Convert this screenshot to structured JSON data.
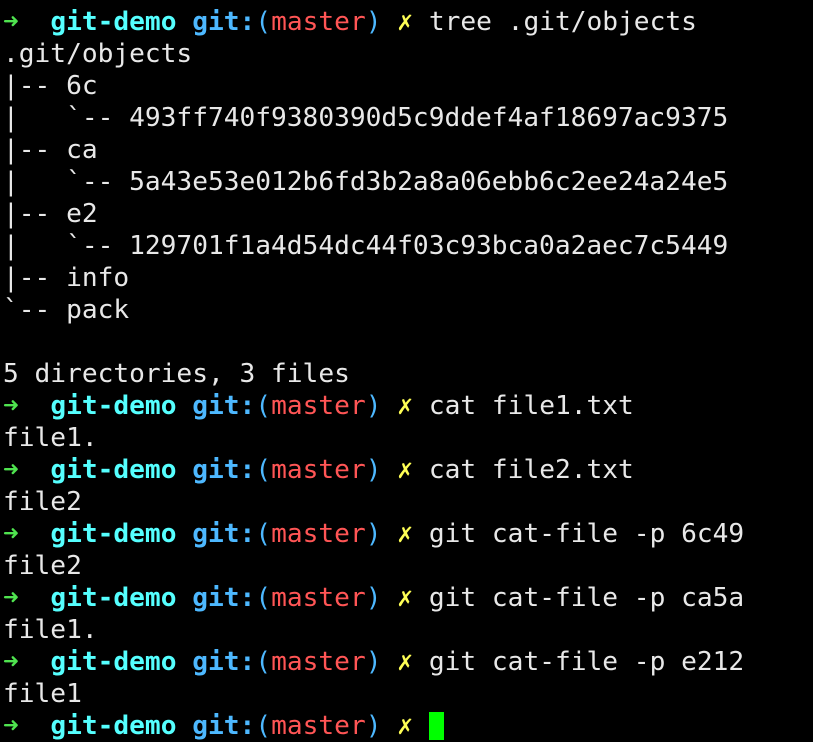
{
  "terminal": {
    "colors": {
      "arrow": "#4fe34f",
      "dir": "#55ffff",
      "git": "#4db8ff",
      "branch": "#ff5555",
      "dirty": "#ffff55",
      "text": "#e8e8e8",
      "cursor": "#00ff00"
    },
    "prompt": {
      "arrow": "➜",
      "dir": "git-demo",
      "git_label": "git:",
      "branch": "master",
      "dirty_mark": "✗"
    },
    "lines": [
      {
        "type": "output",
        "text": "  ` "
      },
      {
        "type": "prompt",
        "command": "tree .git/objects"
      },
      {
        "type": "output",
        "text": ".git/objects"
      },
      {
        "type": "output",
        "text": "|-- 6c"
      },
      {
        "type": "output",
        "text": "|   `-- 493ff740f9380390d5c9ddef4af18697ac9375"
      },
      {
        "type": "output",
        "text": "|-- ca"
      },
      {
        "type": "output",
        "text": "|   `-- 5a43e53e012b6fd3b2a8a06ebb6c2ee24a24e5"
      },
      {
        "type": "output",
        "text": "|-- e2"
      },
      {
        "type": "output",
        "text": "|   `-- 129701f1a4d54dc44f03c93bca0a2aec7c5449"
      },
      {
        "type": "output",
        "text": "|-- info"
      },
      {
        "type": "output",
        "text": "`-- pack"
      },
      {
        "type": "output",
        "text": ""
      },
      {
        "type": "output",
        "text": "5 directories, 3 files"
      },
      {
        "type": "prompt",
        "command": "cat file1.txt"
      },
      {
        "type": "output",
        "text": "file1."
      },
      {
        "type": "prompt",
        "command": "cat file2.txt"
      },
      {
        "type": "output",
        "text": "file2"
      },
      {
        "type": "prompt",
        "command": "git cat-file -p 6c49"
      },
      {
        "type": "output",
        "text": "file2"
      },
      {
        "type": "prompt",
        "command": "git cat-file -p ca5a"
      },
      {
        "type": "output",
        "text": "file1."
      },
      {
        "type": "prompt",
        "command": "git cat-file -p e212"
      },
      {
        "type": "output",
        "text": "file1"
      },
      {
        "type": "prompt",
        "command": "",
        "cursor": true
      }
    ]
  }
}
